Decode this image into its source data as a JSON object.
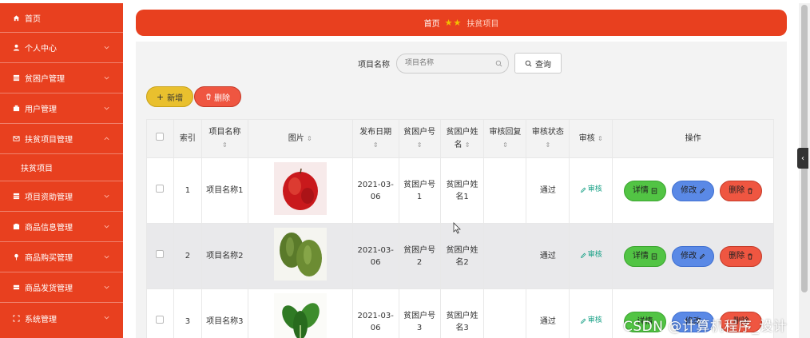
{
  "sidebar": {
    "items": [
      {
        "label": "首页",
        "icon": "home-icon"
      },
      {
        "label": "个人中心",
        "icon": "user-icon"
      },
      {
        "label": "贫困户管理",
        "icon": "grid-icon"
      },
      {
        "label": "用户管理",
        "icon": "grid-icon"
      },
      {
        "label": "扶贫项目管理",
        "icon": "mail-icon",
        "expanded": true
      },
      {
        "label": "扶贫项目",
        "sub": true
      },
      {
        "label": "项目资助管理",
        "icon": "grid-icon"
      },
      {
        "label": "商品信息管理",
        "icon": "grid-icon"
      },
      {
        "label": "商品购买管理",
        "icon": "pin-icon"
      },
      {
        "label": "商品发货管理",
        "icon": "grid-icon"
      },
      {
        "label": "系统管理",
        "icon": "frame-icon"
      }
    ]
  },
  "breadcrumb": {
    "home": "首页",
    "current": "扶贫项目",
    "stars": "★★"
  },
  "search": {
    "label": "项目名称",
    "placeholder": "项目名称",
    "button": "查询"
  },
  "toolbar": {
    "add_label": "新增",
    "delete_label": "删除"
  },
  "table": {
    "headers": {
      "index": "索引",
      "name": "项目名称",
      "image": "图片",
      "date": "发布日期",
      "household_no": "贫困户号",
      "household_name": "贫困户姓名",
      "reply": "审核回复",
      "status": "审核状态",
      "audit": "审核",
      "actions": "操作"
    },
    "rows": [
      {
        "index": "1",
        "name": "项目名称1",
        "date": "2021-03-06",
        "household_no": "贫困户号1",
        "household_name": "贫困户姓名1",
        "reply": "",
        "status": "通过",
        "image": "apple-image"
      },
      {
        "index": "2",
        "name": "项目名称2",
        "date": "2021-03-06",
        "household_no": "贫困户号2",
        "household_name": "贫困户姓名2",
        "reply": "",
        "status": "通过",
        "image": "winter-melon-image"
      },
      {
        "index": "3",
        "name": "项目名称3",
        "date": "2021-03-06",
        "household_no": "贫困户号3",
        "household_name": "贫困户姓名3",
        "reply": "",
        "status": "通过",
        "image": "spinach-image"
      }
    ],
    "audit_label": "审核",
    "detail_label": "详情",
    "edit_label": "修改",
    "delete_label": "删除"
  },
  "watermark": "CSDN @计算机程序_设计",
  "colors": {
    "primary": "#e8401f",
    "yellow": "#e9c02e",
    "red": "#ef5641",
    "green": "#52c444",
    "blue": "#5a89e6",
    "teal": "#16a085"
  }
}
